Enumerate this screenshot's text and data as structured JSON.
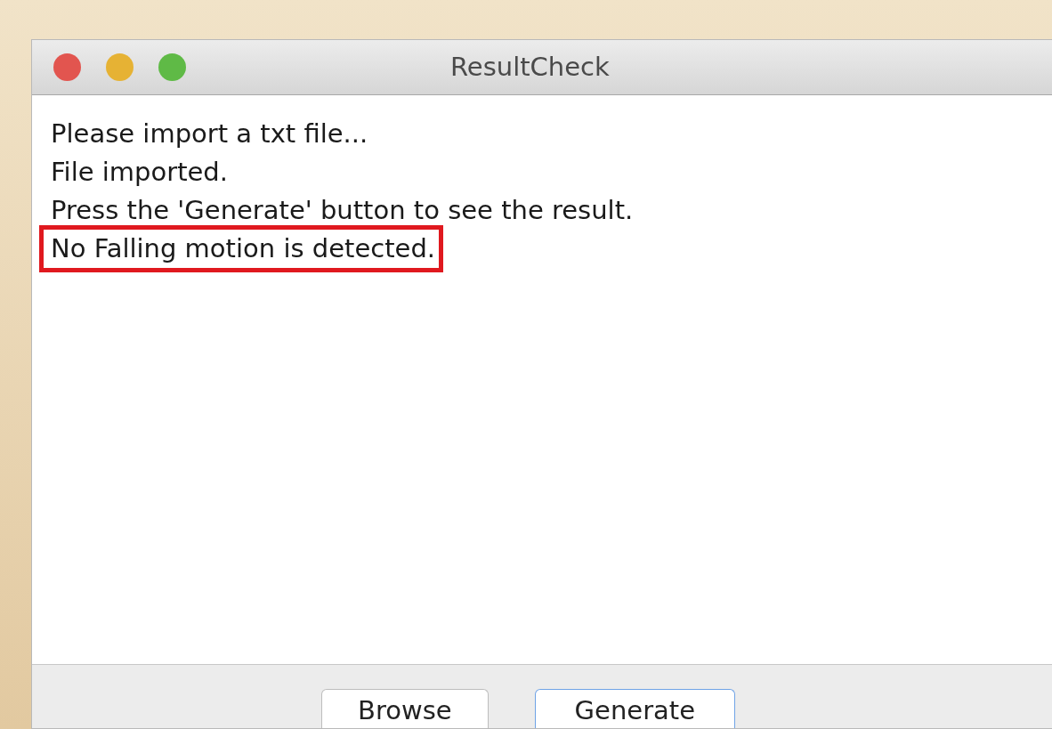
{
  "window": {
    "title": "ResultCheck"
  },
  "log_lines": [
    {
      "text": "Please import a txt file...",
      "highlighted": false
    },
    {
      "text": "File imported.",
      "highlighted": false
    },
    {
      "text": "Press the 'Generate' button to see the result.",
      "highlighted": false
    },
    {
      "text": "No Falling motion is detected.",
      "highlighted": true
    }
  ],
  "buttons": [
    {
      "label": "Browse",
      "default": false
    },
    {
      "label": "Generate",
      "default": true
    }
  ]
}
